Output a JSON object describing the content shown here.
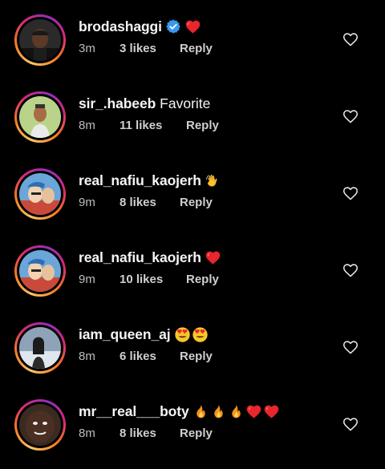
{
  "comments": [
    {
      "username": "brodashaggi",
      "verified": true,
      "text": "",
      "emojis": [
        "red-heart"
      ],
      "time": "3m",
      "likes": "3 likes",
      "reply": "Reply",
      "avatar_bg": "#2a2a2a"
    },
    {
      "username": "sir_.habeeb",
      "verified": false,
      "text": "Favorite",
      "emojis": [],
      "time": "8m",
      "likes": "11 likes",
      "reply": "Reply",
      "avatar_bg": "#b9d48a"
    },
    {
      "username": "real_nafiu_kaojerh",
      "verified": false,
      "text": "",
      "emojis": [
        "waving-hand"
      ],
      "time": "9m",
      "likes": "8 likes",
      "reply": "Reply",
      "avatar_bg": "#6aa6d8"
    },
    {
      "username": "real_nafiu_kaojerh",
      "verified": false,
      "text": "",
      "emojis": [
        "red-heart"
      ],
      "time": "9m",
      "likes": "10 likes",
      "reply": "Reply",
      "avatar_bg": "#6aa6d8"
    },
    {
      "username": "iam_queen_aj",
      "verified": false,
      "text": "",
      "emojis": [
        "heart-eyes",
        "heart-eyes"
      ],
      "time": "8m",
      "likes": "6 likes",
      "reply": "Reply",
      "avatar_bg": "#8fa3b8"
    },
    {
      "username": "mr__real___boty",
      "verified": false,
      "text": "",
      "emojis": [
        "fire",
        "fire",
        "fire",
        "red-heart",
        "red-heart"
      ],
      "time": "8m",
      "likes": "8 likes",
      "reply": "Reply",
      "avatar_bg": "#3a2a22"
    }
  ],
  "colors": {
    "background": "#000000",
    "text_primary": "#f5f5f5",
    "text_secondary": "#c8c8c8",
    "verified_blue": "#3897f0",
    "heart_red": "#ed1c2e"
  }
}
